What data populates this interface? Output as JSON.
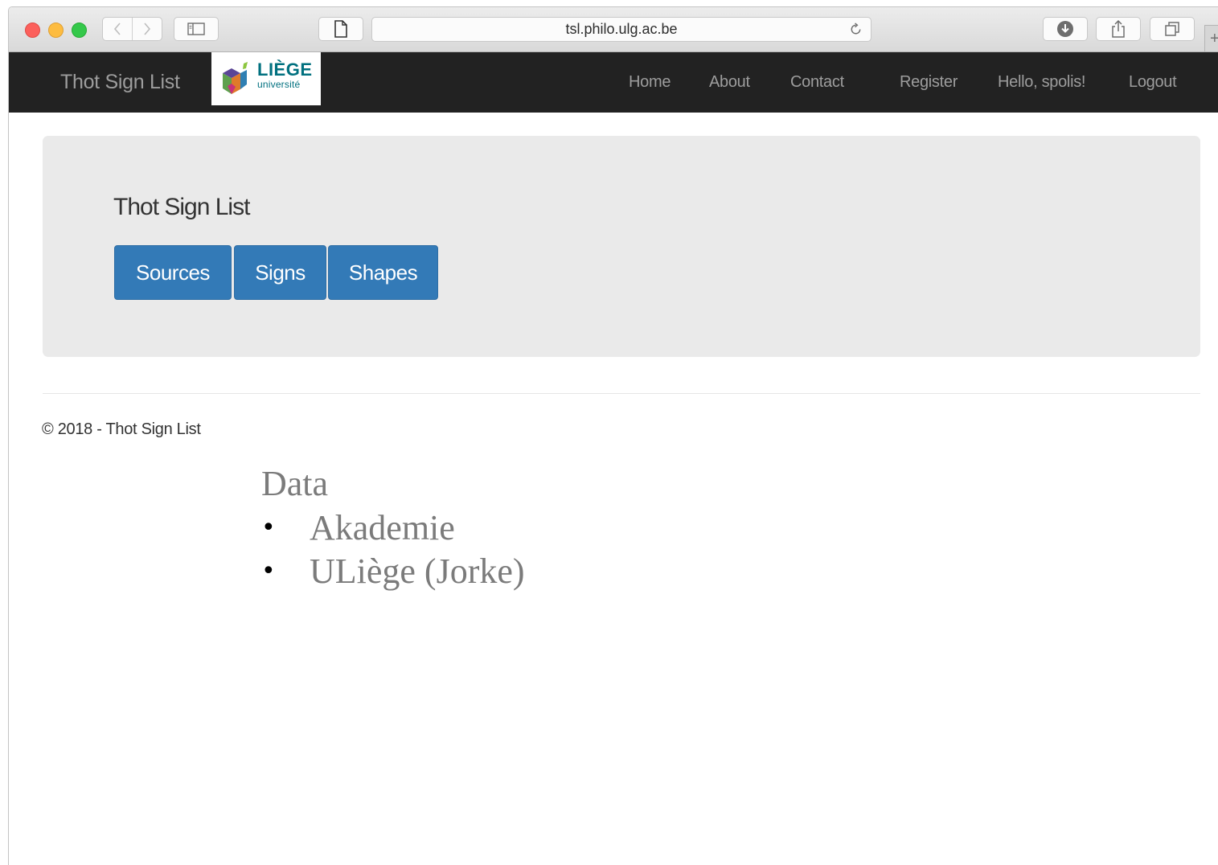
{
  "browser": {
    "url": "tsl.philo.ulg.ac.be",
    "icons": {
      "back": "chevron-left-icon",
      "forward": "chevron-right-icon",
      "sidebar": "sidebar-icon",
      "page": "page-icon",
      "reload": "reload-icon",
      "downloads": "download-icon",
      "share": "share-icon",
      "tabs": "tabs-icon"
    }
  },
  "navbar": {
    "brand": "Thot Sign List",
    "logo": {
      "word": "LIÈGE",
      "sub": "université"
    },
    "links": {
      "home": "Home",
      "about": "About",
      "contact": "Contact",
      "register": "Register",
      "hello": "Hello, spolis!",
      "logout": "Logout"
    },
    "colors": {
      "background": "#222222",
      "link": "#9d9d9d"
    }
  },
  "jumbotron": {
    "title": "Thot Sign List",
    "buttons": {
      "sources": "Sources",
      "signs": "Signs",
      "shapes": "Shapes"
    },
    "colors": {
      "background": "#eaeaea",
      "button": "#337ab7"
    }
  },
  "footer": {
    "text": "© 2018 - Thot Sign List"
  },
  "slide": {
    "heading": "Data",
    "items": [
      "Akademie",
      "ULiège (Jorke)"
    ]
  }
}
